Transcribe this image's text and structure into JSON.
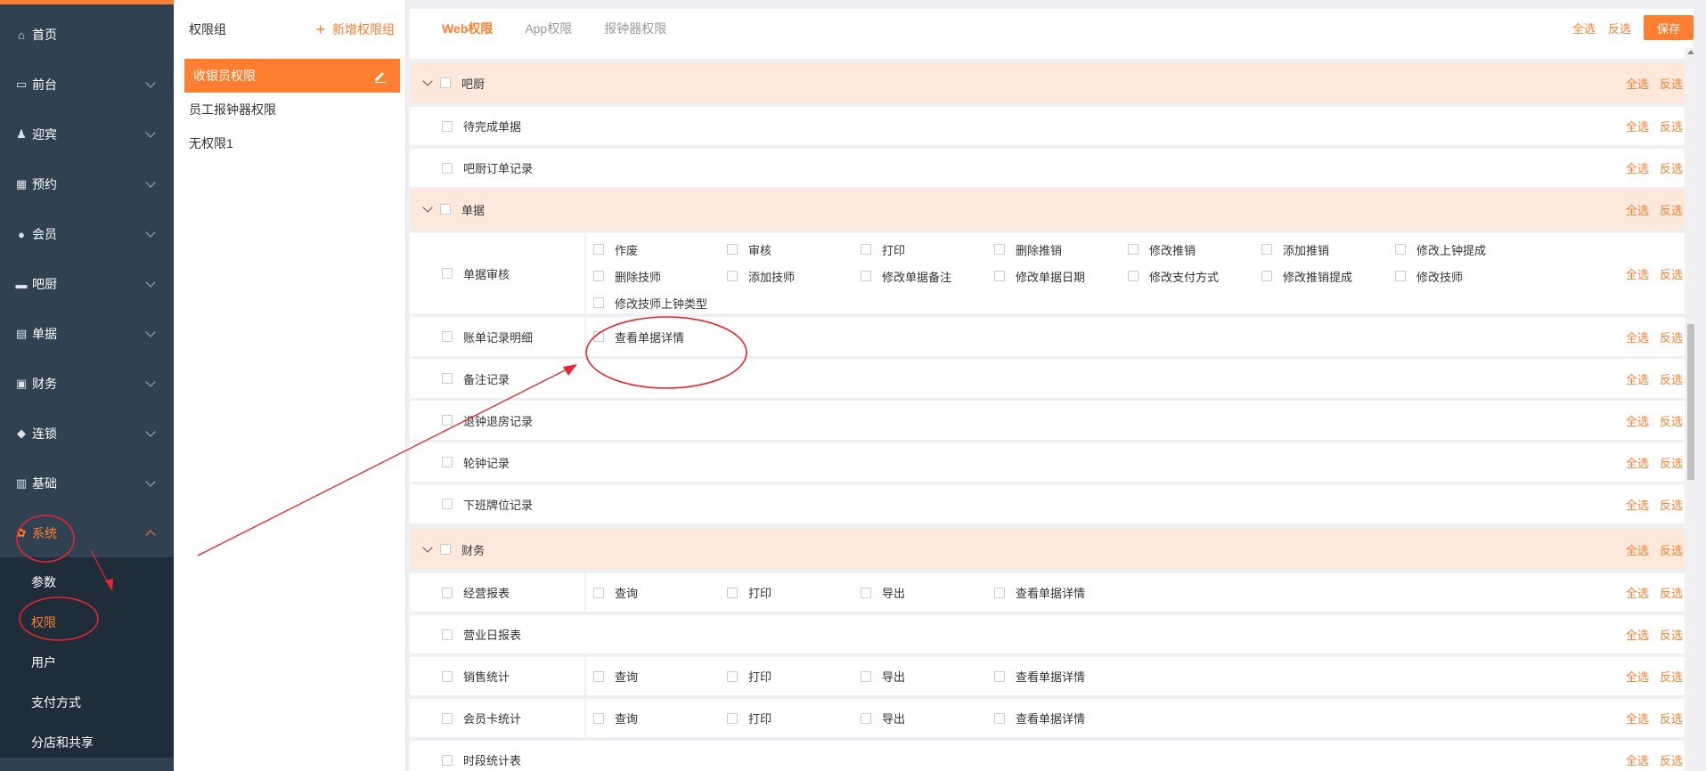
{
  "sidebar": {
    "items": [
      {
        "label": "首页",
        "icon": "home-icon",
        "glyph": "⌂"
      },
      {
        "label": "前台",
        "icon": "monitor-icon",
        "glyph": "▭"
      },
      {
        "label": "迎宾",
        "icon": "reception-icon",
        "glyph": "♟"
      },
      {
        "label": "预约",
        "icon": "calendar-icon",
        "glyph": "▦"
      },
      {
        "label": "会员",
        "icon": "user-icon",
        "glyph": "●"
      },
      {
        "label": "吧厨",
        "icon": "coffee-icon",
        "glyph": "▬"
      },
      {
        "label": "单据",
        "icon": "clipboard-icon",
        "glyph": "▤"
      },
      {
        "label": "财务",
        "icon": "finance-icon",
        "glyph": "▣"
      },
      {
        "label": "连锁",
        "icon": "cube-icon",
        "glyph": "◆"
      },
      {
        "label": "基础",
        "icon": "grid-icon",
        "glyph": "▥"
      },
      {
        "label": "系统",
        "icon": "gear-icon",
        "glyph": "✿"
      }
    ],
    "sub_items": [
      {
        "label": "参数"
      },
      {
        "label": "权限"
      },
      {
        "label": "用户"
      },
      {
        "label": "支付方式"
      },
      {
        "label": "分店和共享"
      }
    ]
  },
  "groups": {
    "title": "权限组",
    "add_label": "新增权限组",
    "items": [
      {
        "label": "收银员权限"
      },
      {
        "label": "员工报钟器权限"
      },
      {
        "label": "无权限1"
      }
    ]
  },
  "tabs": [
    {
      "label": "Web权限"
    },
    {
      "label": "App权限"
    },
    {
      "label": "报钟器权限"
    }
  ],
  "actions": {
    "select_all": "全选",
    "invert": "反选",
    "save": "保存"
  },
  "sections": [
    {
      "title": "吧厨",
      "rows": [
        {
          "name": "待完成单据",
          "options": []
        },
        {
          "name": "吧厨订单记录",
          "options": []
        }
      ]
    },
    {
      "title": "单据",
      "rows": [
        {
          "name": "单据审核",
          "options": [
            "作废",
            "审核",
            "打印",
            "删除推销",
            "修改推销",
            "添加推销",
            "修改上钟提成",
            "删除技师",
            "添加技师",
            "修改单据备注",
            "修改单据日期",
            "修改支付方式",
            "修改推销提成",
            "修改技师",
            "修改技师上钟类型"
          ]
        },
        {
          "name": "账单记录明细",
          "options": [
            "查看单据详情"
          ]
        },
        {
          "name": "备注记录",
          "options": []
        },
        {
          "name": "退钟退房记录",
          "options": []
        },
        {
          "name": "轮钟记录",
          "options": []
        },
        {
          "name": "下班牌位记录",
          "options": []
        }
      ]
    },
    {
      "title": "财务",
      "rows": [
        {
          "name": "经营报表",
          "options": [
            "查询",
            "打印",
            "导出",
            "查看单据详情"
          ]
        },
        {
          "name": "营业日报表",
          "options": []
        },
        {
          "name": "销售统计",
          "options": [
            "查询",
            "打印",
            "导出",
            "查看单据详情"
          ]
        },
        {
          "name": "会员卡统计",
          "options": [
            "查询",
            "打印",
            "导出",
            "查看单据详情"
          ]
        },
        {
          "name": "时段统计表",
          "options": []
        }
      ]
    }
  ],
  "colors": {
    "accent": "#ff7e2f",
    "sidebar": "#304152",
    "section_bg": "#fde8dc",
    "annotation": "#e8262d"
  }
}
